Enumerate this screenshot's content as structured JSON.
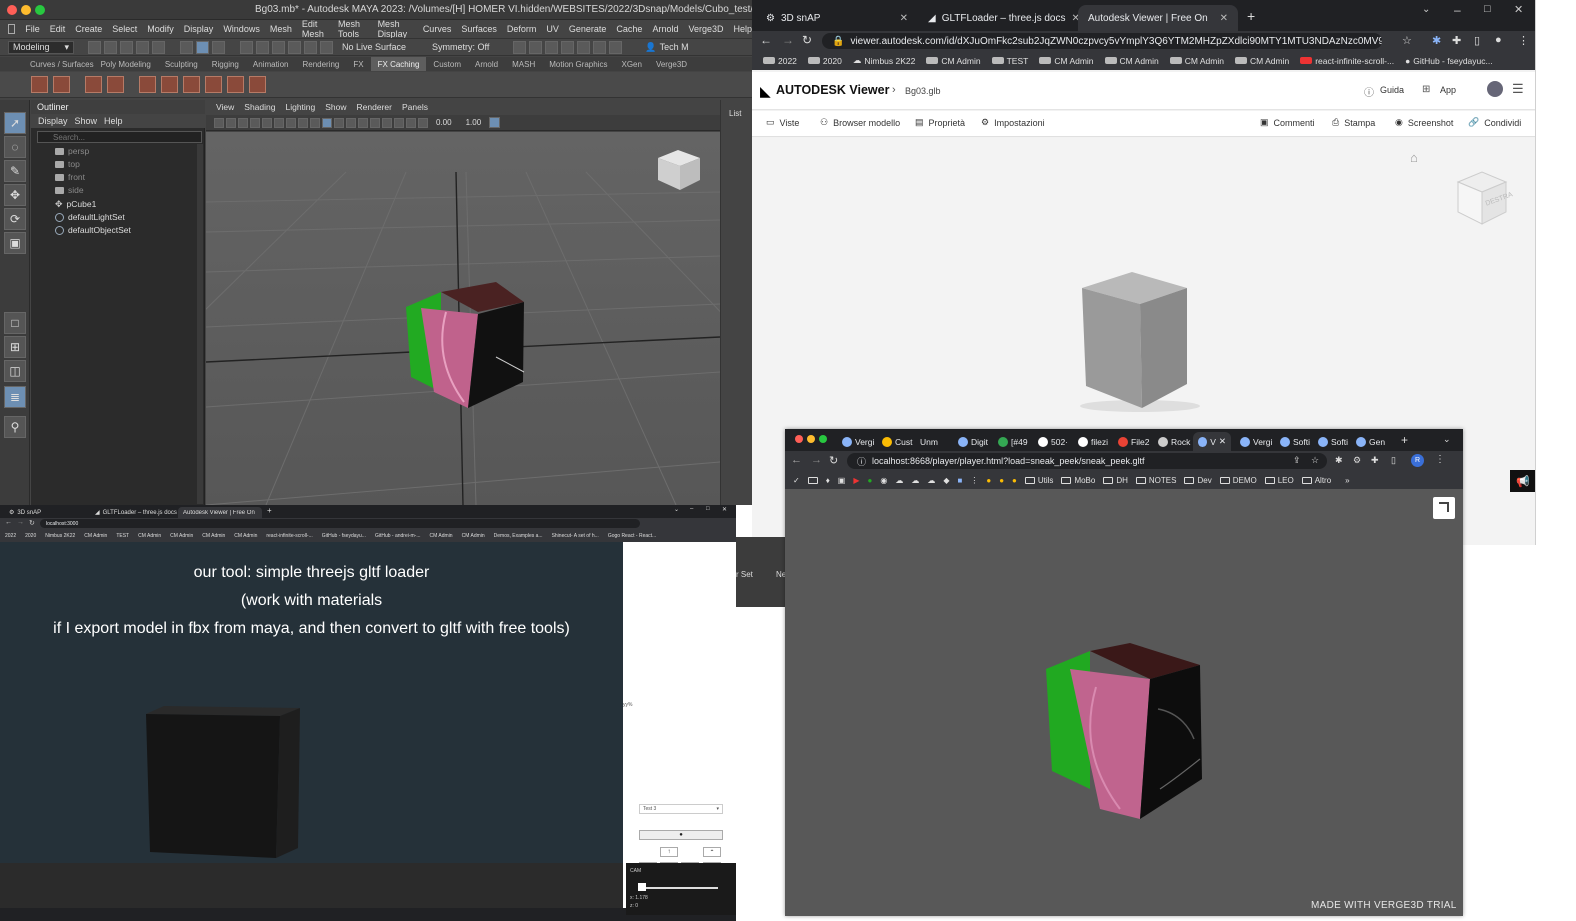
{
  "maya": {
    "title": "Bg03.mb* - Autodesk MAYA 2023: /Volumes/[H] HOMER VI.hidden/WEBSITES/2022/3Dsnap/Models/Cubo_test/Bg",
    "menus": [
      "File",
      "Edit",
      "Create",
      "Select",
      "Modify",
      "Display",
      "Windows",
      "Mesh",
      "Edit Mesh",
      "Mesh Tools",
      "Mesh Display",
      "Curves",
      "Surfaces",
      "Deform",
      "UV",
      "Generate",
      "Cache",
      "Arnold",
      "Verge3D",
      "Help"
    ],
    "workspace": "Modeling",
    "live_surface": "No Live Surface",
    "symmetry": "Symmetry: Off",
    "tech_label": "Tech M",
    "shelf_tabs": [
      "Curves / Surfaces",
      "Poly Modeling",
      "Sculpting",
      "Rigging",
      "Animation",
      "Rendering",
      "FX",
      "FX Caching",
      "Custom",
      "Arnold",
      "MASH",
      "Motion Graphics",
      "XGen",
      "Verge3D"
    ],
    "active_shelf_tab": "FX Caching",
    "outliner": {
      "title": "Outliner",
      "menu": [
        "Display",
        "Show",
        "Help"
      ],
      "search_placeholder": "Search...",
      "items": [
        "persp",
        "top",
        "front",
        "side",
        "pCube1",
        "defaultLightSet",
        "defaultObjectSet"
      ]
    },
    "viewport_menu": [
      "View",
      "Shading",
      "Lighting",
      "Show",
      "Renderer",
      "Panels"
    ],
    "viewport_values": [
      "0.00",
      "1.00"
    ],
    "right_label": "List"
  },
  "adesk": {
    "tabs": [
      {
        "label": "3D snAP",
        "active": false
      },
      {
        "label": "GLTFLoader – three.js docs",
        "active": false
      },
      {
        "label": "Autodesk Viewer | Free Online Fi",
        "active": true
      }
    ],
    "url": "viewer.autodesk.com/id/dXJuOmFkc2sub2JqZWN0czpvcy5vYmplY3Q6YTM2MHZpZXdlci90MTY1MTU3NDAzNzc0MV9mM2Y...",
    "bookmarks": [
      "2022",
      "2020",
      "Nimbus 2K22",
      "CM Admin",
      "TEST",
      "CM Admin",
      "CM Admin",
      "CM Admin",
      "CM Admin",
      "react-infinite-scroll-...",
      "GitHub - fseydayuc..."
    ],
    "brand": "AUTODESK Viewer",
    "file": "Bg03.glb",
    "help": "Guida",
    "app": "App",
    "tools_left": [
      "Viste",
      "Browser modello",
      "Proprietà",
      "Impostazioni"
    ],
    "tools_right": [
      "Commenti",
      "Stampa",
      "Screenshot",
      "Condividi"
    ],
    "cube_label": "DESTRA"
  },
  "small": {
    "tabs": [
      "3D snAP",
      "GLTFLoader – three.js docs",
      "Autodesk Viewer | Free Online F..."
    ],
    "url": "localhost:3000",
    "bookmarks": [
      "2022",
      "2020",
      "Nimbus 2K22",
      "CM Admin",
      "TEST",
      "CM Admin",
      "CM Admin",
      "CM Admin",
      "CM Admin",
      "react-infinite-scroll-...",
      "GitHub - fseydayu...",
      "GitHub - andrei-m-...",
      "CM Admin",
      "CM Admin",
      "Demos, Examples a...",
      "Shinecut- A set of h...",
      "Gogo React - React..."
    ],
    "annotation": [
      "our tool: simple threejs gltf loader",
      "(work with materials",
      "if I export model in fbx from maya, and then convert to gltf with free tools)"
    ],
    "gui_select": "Test 3",
    "gui_side": "yy%",
    "gui_dark_labels": [
      "CAM",
      "x: 1.178",
      "z: 0"
    ],
    "gap_label_1": "r Set",
    "gap_label_2": "Ne"
  },
  "verge": {
    "tabs": [
      "Vergi",
      "Cust",
      "Unm",
      "Digit",
      "[#49",
      "502·",
      "filezi",
      "File2",
      "Rock",
      "V",
      "Vergi",
      "Softi",
      "Softi",
      "Gen"
    ],
    "url": "localhost:8668/player/player.html?load=sneak_peek/sneak_peek.gltf",
    "bookmarks": [
      "Utils",
      "MoBo",
      "DH",
      "NOTES",
      "Dev",
      "DEMO",
      "LEO",
      "Altro"
    ],
    "profile": "R",
    "watermark": "MADE WITH VERGE3D TRIAL"
  },
  "colors": {
    "maya_bg": "#444444",
    "chrome_dark": "#202124",
    "chrome_mid": "#35363a",
    "cube_green": "#1faa1f",
    "cube_pink": "#c0648e",
    "small_bg": "#253139"
  }
}
